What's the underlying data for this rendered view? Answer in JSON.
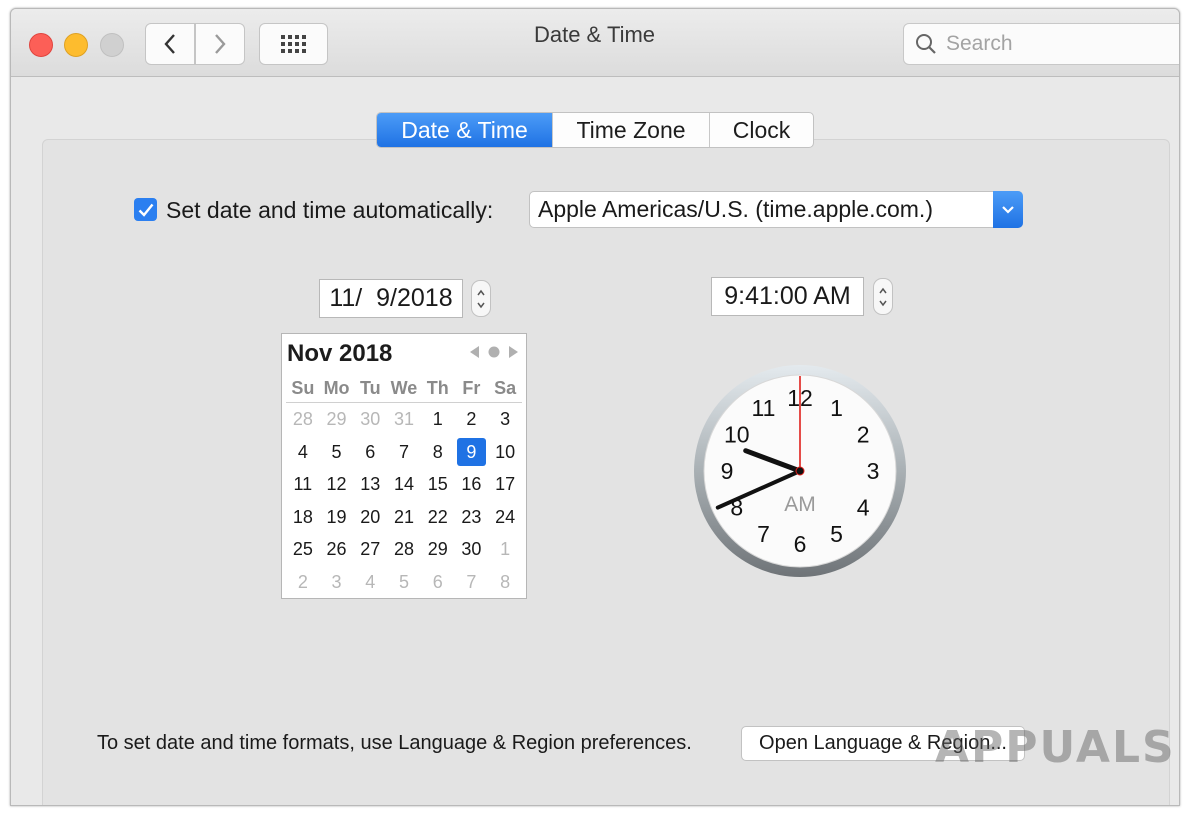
{
  "window": {
    "title": "Date & Time",
    "search_placeholder": "Search"
  },
  "tabs": [
    {
      "label": "Date & Time",
      "active": true
    },
    {
      "label": "Time Zone",
      "active": false
    },
    {
      "label": "Clock",
      "active": false
    }
  ],
  "auto": {
    "checked": true,
    "label": "Set date and time automatically:",
    "server": "Apple Americas/U.S. (time.apple.com.)"
  },
  "date_value": "11/  9/2018",
  "time_value": "9:41:00 AM",
  "calendar": {
    "month_label": "Nov 2018",
    "weekdays": [
      "Su",
      "Mo",
      "Tu",
      "We",
      "Th",
      "Fr",
      "Sa"
    ],
    "weeks": [
      [
        {
          "d": "28",
          "m": true
        },
        {
          "d": "29",
          "m": true
        },
        {
          "d": "30",
          "m": true
        },
        {
          "d": "31",
          "m": true
        },
        {
          "d": "1"
        },
        {
          "d": "2"
        },
        {
          "d": "3"
        }
      ],
      [
        {
          "d": "4"
        },
        {
          "d": "5"
        },
        {
          "d": "6"
        },
        {
          "d": "7"
        },
        {
          "d": "8"
        },
        {
          "d": "9",
          "sel": true
        },
        {
          "d": "10"
        }
      ],
      [
        {
          "d": "11"
        },
        {
          "d": "12"
        },
        {
          "d": "13"
        },
        {
          "d": "14"
        },
        {
          "d": "15"
        },
        {
          "d": "16"
        },
        {
          "d": "17"
        }
      ],
      [
        {
          "d": "18"
        },
        {
          "d": "19"
        },
        {
          "d": "20"
        },
        {
          "d": "21"
        },
        {
          "d": "22"
        },
        {
          "d": "23"
        },
        {
          "d": "24"
        }
      ],
      [
        {
          "d": "25"
        },
        {
          "d": "26"
        },
        {
          "d": "27"
        },
        {
          "d": "28"
        },
        {
          "d": "29"
        },
        {
          "d": "30"
        },
        {
          "d": "1",
          "m": true
        }
      ],
      [
        {
          "d": "2",
          "m": true
        },
        {
          "d": "3",
          "m": true
        },
        {
          "d": "4",
          "m": true
        },
        {
          "d": "5",
          "m": true
        },
        {
          "d": "6",
          "m": true
        },
        {
          "d": "7",
          "m": true
        },
        {
          "d": "8",
          "m": true
        }
      ]
    ]
  },
  "clock": {
    "hour": 9,
    "minute": 41,
    "second": 0,
    "period_label": "AM",
    "numerals": [
      "12",
      "1",
      "2",
      "3",
      "4",
      "5",
      "6",
      "7",
      "8",
      "9",
      "10",
      "11"
    ]
  },
  "footer": {
    "text": "To set date and time formats, use Language & Region preferences.",
    "button_label": "Open Language & Region..."
  },
  "watermark": "APPUALS",
  "colors": {
    "accent": "#1f72e4",
    "second_hand": "#e0201b"
  }
}
